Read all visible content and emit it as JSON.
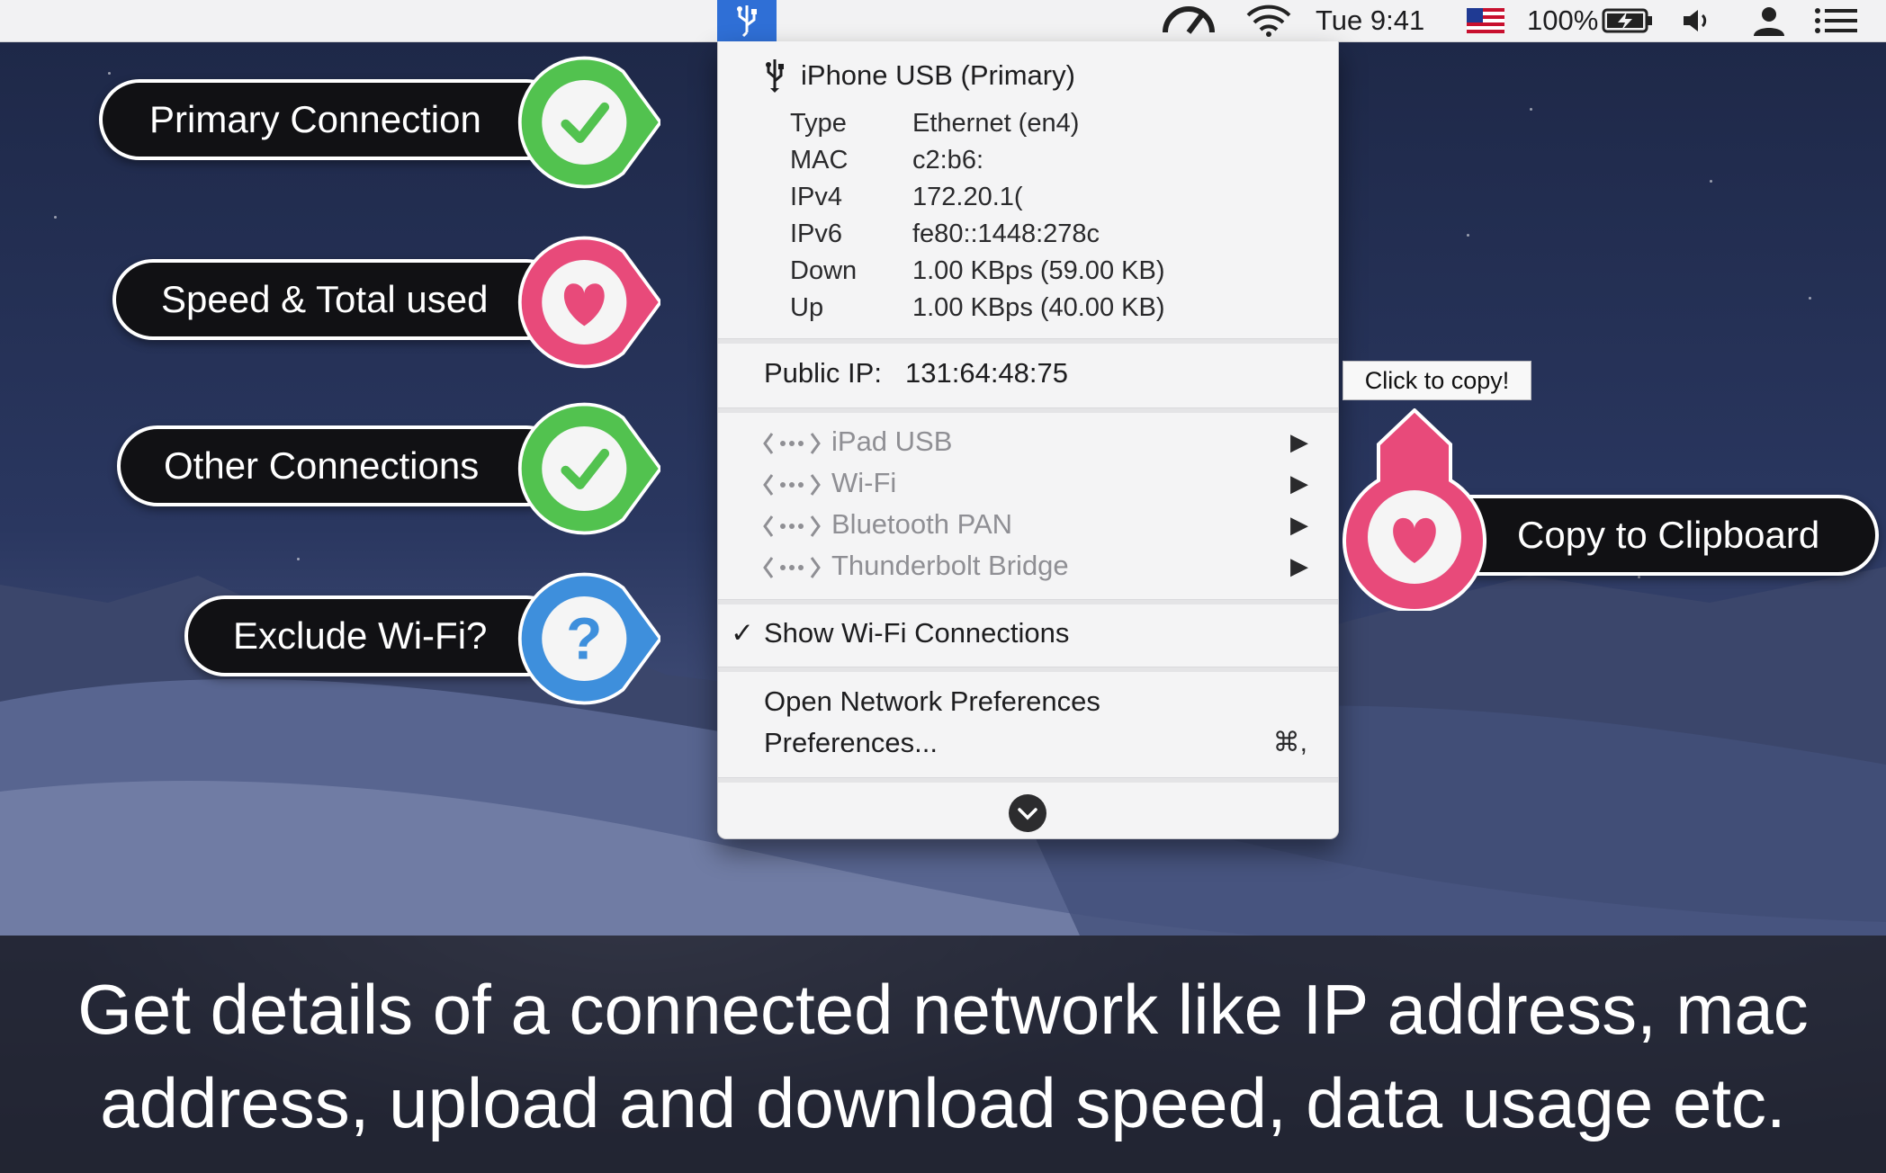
{
  "menubar": {
    "clock": "Tue 9:41",
    "battery": "100%",
    "icons": [
      "usb-icon",
      "speedometer-icon",
      "wifi-icon",
      "us-flag-icon",
      "battery-charging-icon",
      "volume-icon",
      "user-icon",
      "list-icon"
    ]
  },
  "menu": {
    "primary": {
      "title": "iPhone USB (Primary)",
      "rows": [
        {
          "label": "Type",
          "value": "Ethernet (en4)"
        },
        {
          "label": "MAC",
          "value": "c2:b6:"
        },
        {
          "label": "IPv4",
          "value": "172.20.1("
        },
        {
          "label": "IPv6",
          "value": "fe80::1448:278c"
        },
        {
          "label": "Down",
          "value": "1.00 KBps (59.00 KB)"
        },
        {
          "label": "Up",
          "value": "1.00 KBps (40.00 KB)"
        }
      ]
    },
    "public_ip": {
      "label": "Public IP:",
      "value": "131:64:48:75"
    },
    "other_connections": [
      "iPad USB",
      "Wi-Fi",
      "Bluetooth PAN",
      "Thunderbolt Bridge"
    ],
    "submenu_arrow": "▶",
    "show_wifi": {
      "check": "✓",
      "label": "Show Wi-Fi Connections",
      "checked": true
    },
    "open_network_prefs": "Open Network Preferences",
    "preferences": "Preferences...",
    "preferences_shortcut": "⌘,"
  },
  "callouts": {
    "primary_connection": "Primary Connection",
    "speed_total": "Speed & Total used",
    "other_connections": "Other Connections",
    "exclude_wifi": "Exclude Wi-Fi?",
    "copy_to_clipboard": "Copy to Clipboard",
    "question_mark": "?"
  },
  "tooltip": "Click to copy!",
  "caption": "Get details of a connected network like IP address, mac address, upload and download speed, data usage etc.",
  "colors": {
    "green": "#52c24f",
    "pink": "#e84a7a",
    "blue": "#3e8fdc",
    "menubar_active": "#2f6fd6"
  }
}
